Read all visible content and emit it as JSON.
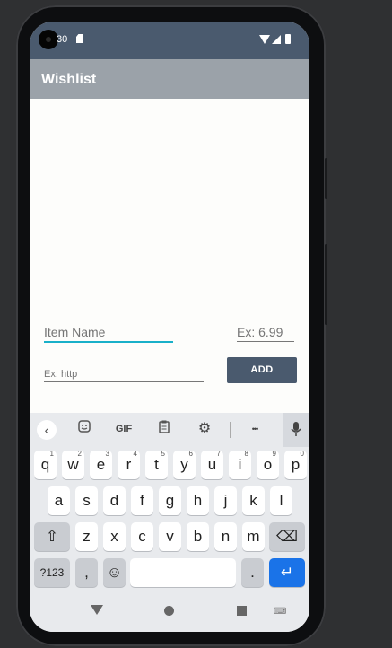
{
  "status": {
    "time": "30"
  },
  "appbar": {
    "title": "Wishlist"
  },
  "form": {
    "name_placeholder": "Item Name",
    "price_placeholder": "Ex: 6.99",
    "url_placeholder": "Ex: http",
    "add_label": "ADD"
  },
  "keyboard": {
    "toolbar": {
      "back": "‹",
      "gif": "GIF",
      "more": "•••"
    },
    "row1": [
      {
        "k": "q",
        "s": "1"
      },
      {
        "k": "w",
        "s": "2"
      },
      {
        "k": "e",
        "s": "3"
      },
      {
        "k": "r",
        "s": "4"
      },
      {
        "k": "t",
        "s": "5"
      },
      {
        "k": "y",
        "s": "6"
      },
      {
        "k": "u",
        "s": "7"
      },
      {
        "k": "i",
        "s": "8"
      },
      {
        "k": "o",
        "s": "9"
      },
      {
        "k": "p",
        "s": "0"
      }
    ],
    "row2": [
      "a",
      "s",
      "d",
      "f",
      "g",
      "h",
      "j",
      "k",
      "l"
    ],
    "row3": [
      "z",
      "x",
      "c",
      "v",
      "b",
      "n",
      "m"
    ],
    "sym": "?123",
    "comma": ",",
    "period": ".",
    "enter": "↵",
    "shift": "⇧",
    "backspace": "⌫",
    "emoji": "☺"
  },
  "colors": {
    "accent": "#19b0c9",
    "primary": "#4a5a6e",
    "appbar": "#9ba2a9",
    "enter": "#1a73e8"
  }
}
